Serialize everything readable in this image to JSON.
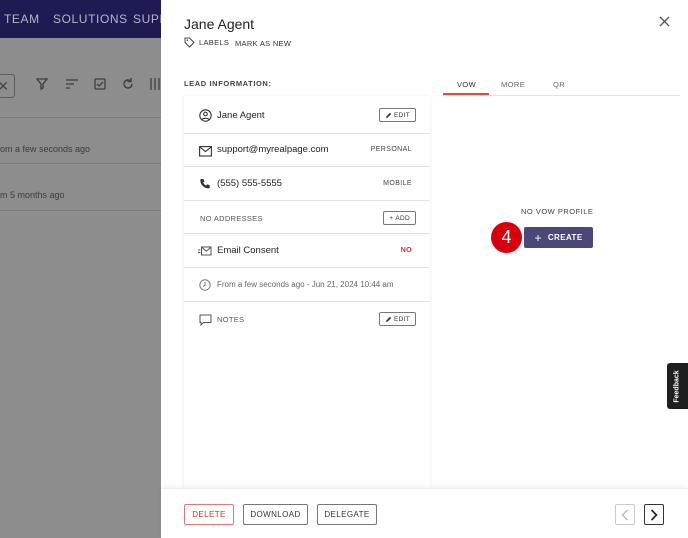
{
  "background": {
    "nav_items": [
      "TEAM",
      "SOLUTIONS",
      "SUPP"
    ],
    "rows": [
      {
        "text": "om a few seconds ago"
      },
      {
        "text": "m 5 months ago"
      }
    ]
  },
  "drawer": {
    "title": "Jane Agent",
    "labels_label": "LABELS",
    "mark_as_new_label": "MARK AS NEW",
    "lead_info_label": "LEAD INFORMATION:",
    "lead": {
      "name": "Jane Agent",
      "name_edit_label": "EDIT",
      "email": "support@myrealpage.com",
      "email_type": "PERSONAL",
      "phone": "(555) 555-5555",
      "phone_type": "MOBILE",
      "addresses_label": "NO ADDRESSES",
      "add_label": "ADD",
      "consent_label": "Email Consent",
      "consent_value": "NO",
      "activity": "From a few seconds ago - Jun 21, 2024 10:44 am",
      "notes_label": "NOTES",
      "notes_edit_label": "EDIT"
    },
    "tabs": [
      "VOW",
      "MORE",
      "QR"
    ],
    "active_tab": "VOW",
    "no_vow_label": "NO VOW PROFILE",
    "create_label": "CREATE",
    "step_number": "4",
    "footer": {
      "delete_label": "DELETE",
      "download_label": "DOWNLOAD",
      "delegate_label": "DELEGATE"
    }
  },
  "feedback_label": "Feedback",
  "colors": {
    "accent": "#4b4779",
    "nav_bg": "#1d1b52",
    "danger": "#d32f2f",
    "tab_underline": "#e84a3c",
    "step_badge": "#d7000f"
  }
}
